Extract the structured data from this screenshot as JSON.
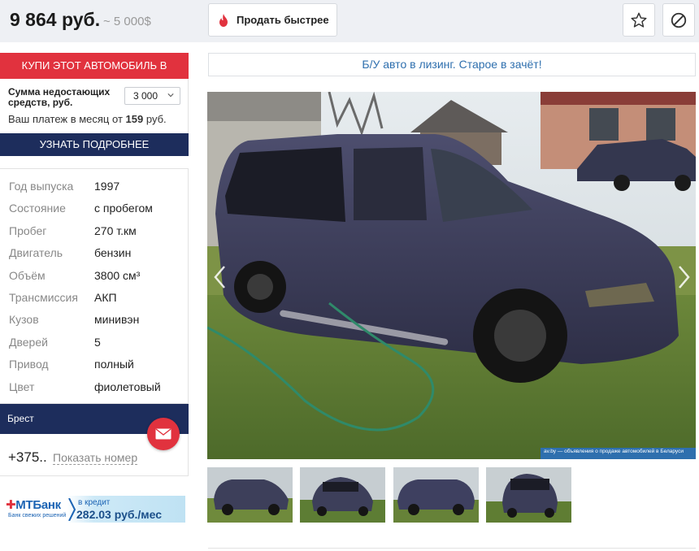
{
  "header": {
    "price": "9 864 руб.",
    "price_usd": "~ 5 000$",
    "sell_faster": "Продать быстрее",
    "favorite_icon": "star-icon",
    "block_icon": "block-icon",
    "sell_icon": "flame-icon"
  },
  "leasing": {
    "title": "КУПИ ЭТОТ АВТОМОБИЛЬ В ЛИЗИНГ",
    "amount_label": "Сумма недостающих средств, руб.",
    "amount_value": "3 000",
    "payment_prefix": "Ваш платеж в месяц от",
    "payment_value": "159",
    "payment_suffix": "руб.",
    "more_button": "УЗНАТЬ ПОДРОБНЕЕ"
  },
  "specs": [
    {
      "key": "Год выпуска",
      "value": "1997"
    },
    {
      "key": "Состояние",
      "value": "с пробегом"
    },
    {
      "key": "Пробег",
      "value": "270 т.км"
    },
    {
      "key": "Двигатель",
      "value": "бензин"
    },
    {
      "key": "Объём",
      "value": "3800 см³"
    },
    {
      "key": "Трансмиссия",
      "value": "АКП"
    },
    {
      "key": "Кузов",
      "value": "минивэн"
    },
    {
      "key": "Дверей",
      "value": "5"
    },
    {
      "key": "Привод",
      "value": "полный"
    },
    {
      "key": "Цвет",
      "value": "фиолетовый"
    }
  ],
  "contact": {
    "city": "Брест",
    "phone": "+375..",
    "show_number": "Показать номер",
    "mail_icon": "mail-icon"
  },
  "bank": {
    "logo": "MTБанк",
    "tagline": "Банк свежих решений",
    "credit_label": "в кредит",
    "amount": "282.03 руб./мес"
  },
  "promo": {
    "text": "Б/У авто в лизинг. Старое в зачёт!"
  },
  "photo": {
    "watermark": "av.by — объявления о продаже автомобилей в Беларуси",
    "main_alt": "Минивэн фиолетового цвета во дворе",
    "thumbnail_count": 4
  },
  "colors": {
    "accent_red": "#e1323e",
    "navy": "#1d2d5c",
    "link_blue": "#2e6fae",
    "topbar_bg": "#eef0f4"
  }
}
